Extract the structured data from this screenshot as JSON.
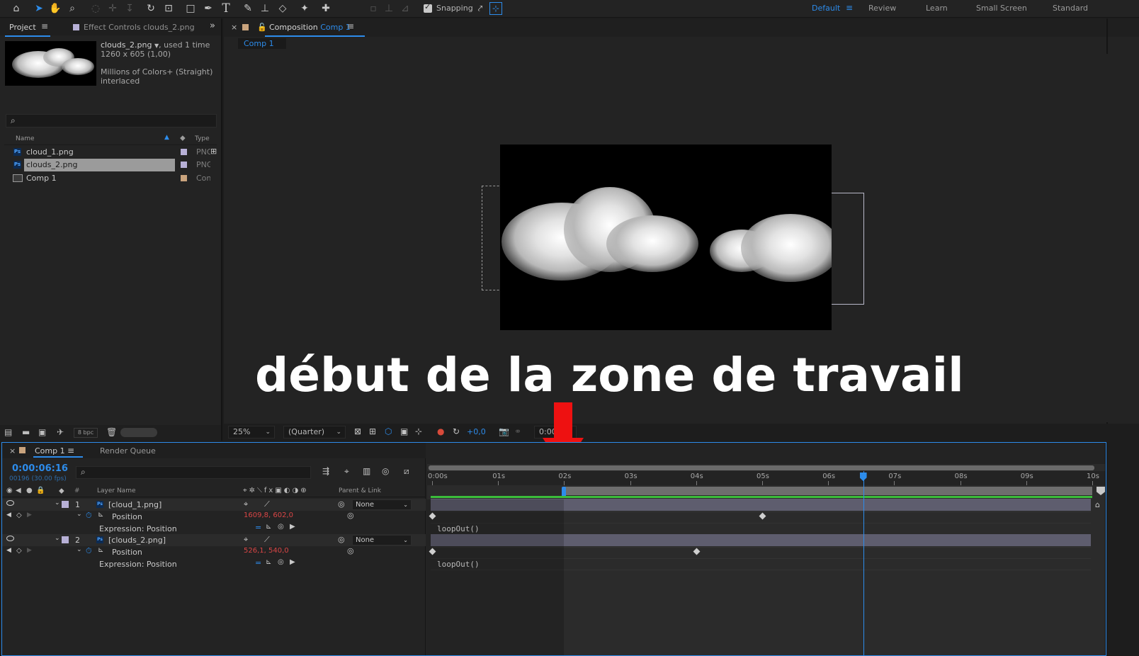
{
  "toolbar": {
    "snapping_label": "Snapping",
    "workspaces": [
      "Default",
      "Review",
      "Learn",
      "Small Screen",
      "Standard"
    ],
    "active_workspace": "Default"
  },
  "project_panel": {
    "tab_project": "Project",
    "tab_effect_controls": "Effect Controls clouds_2.png",
    "preview": {
      "file_name": "clouds_2.png",
      "usage": ", used 1 time",
      "dimensions": "1260 x 605 (1,00)",
      "color_info": "Millions of Colors+ (Straight)",
      "interlace": "interlaced"
    },
    "column_name": "Name",
    "column_type": "Type",
    "items": [
      {
        "name": "cloud_1.png",
        "type": "PNG",
        "icon": "photoshop-icon",
        "label_color": "#b7b0d6"
      },
      {
        "name": "clouds_2.png",
        "type": "PNG",
        "icon": "photoshop-icon",
        "label_color": "#b7b0d6",
        "selected": true
      },
      {
        "name": "Comp 1",
        "type": "Con",
        "icon": "composition-icon",
        "label_color": "#c9a37d"
      }
    ],
    "bpc": "8 bpc"
  },
  "composition_panel": {
    "tab_prefix": "Composition",
    "tab_comp_name": "Comp 1",
    "subtab": "Comp 1",
    "zoom": "25%",
    "resolution": "(Quarter)",
    "exposure": "+0,0",
    "timecode": "0:00"
  },
  "overlay_caption": "début de la zone de travail",
  "timeline": {
    "tab_comp": "Comp 1",
    "tab_render_queue": "Render Queue",
    "current_time": "0:00:06:16",
    "frame_info": "00196 (30.00 fps)",
    "col_layer_name": "Layer Name",
    "col_parent": "Parent & Link",
    "ruler": [
      "0:00s",
      "01s",
      "02s",
      "03s",
      "04s",
      "05s",
      "06s",
      "07s",
      "08s",
      "09s",
      "10s"
    ],
    "work_area_start_s": 2.0,
    "playhead_s": 6.53,
    "layers": [
      {
        "index": "1",
        "name": "[cloud_1.png]",
        "parent": "None",
        "property": "Position",
        "value": "1609,8, 602,0",
        "expression_label": "Expression: Position",
        "expression": "loopOut()",
        "keyframes_s": [
          0.0,
          5.0
        ]
      },
      {
        "index": "2",
        "name": "[clouds_2.png]",
        "parent": "None",
        "property": "Position",
        "value": "526,1, 540,0",
        "expression_label": "Expression: Position",
        "expression": "loopOut()",
        "keyframes_s": [
          0.0,
          4.0
        ]
      }
    ]
  },
  "colors": {
    "accent_blue": "#2d8ceb",
    "keyframe_value_red": "#d94545",
    "arrow_red": "#ee1111",
    "layer_bar": "#5e5d6e",
    "work_area_green": "#3bbd3b"
  }
}
